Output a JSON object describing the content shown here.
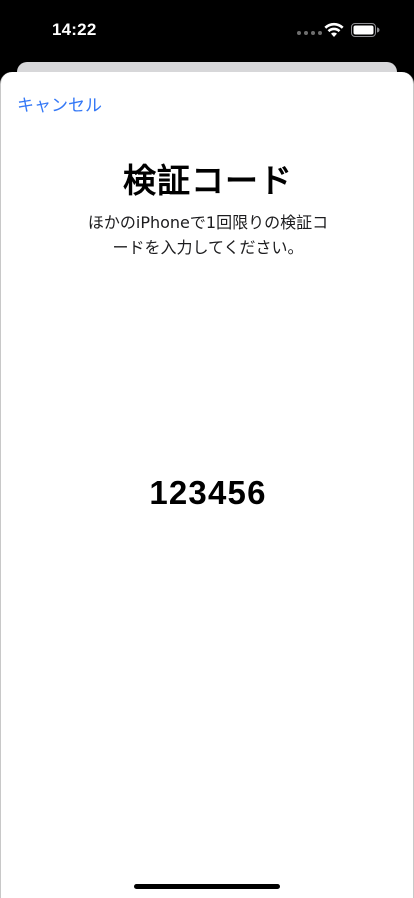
{
  "status_bar": {
    "time": "14:22",
    "wifi_icon": "wifi-icon",
    "battery_icon": "battery-icon",
    "signal_icon": "cellular-dots-icon"
  },
  "sheet": {
    "cancel_label": "キャンセル",
    "title": "検証コード",
    "description": "ほかのiPhoneで1回限りの検証コードを入力してください。",
    "code": "123456"
  },
  "colors": {
    "accent": "#3478f6",
    "status_bar_bg": "#000000",
    "sheet_bg": "#ffffff",
    "back_card": "#d7d7d9"
  }
}
